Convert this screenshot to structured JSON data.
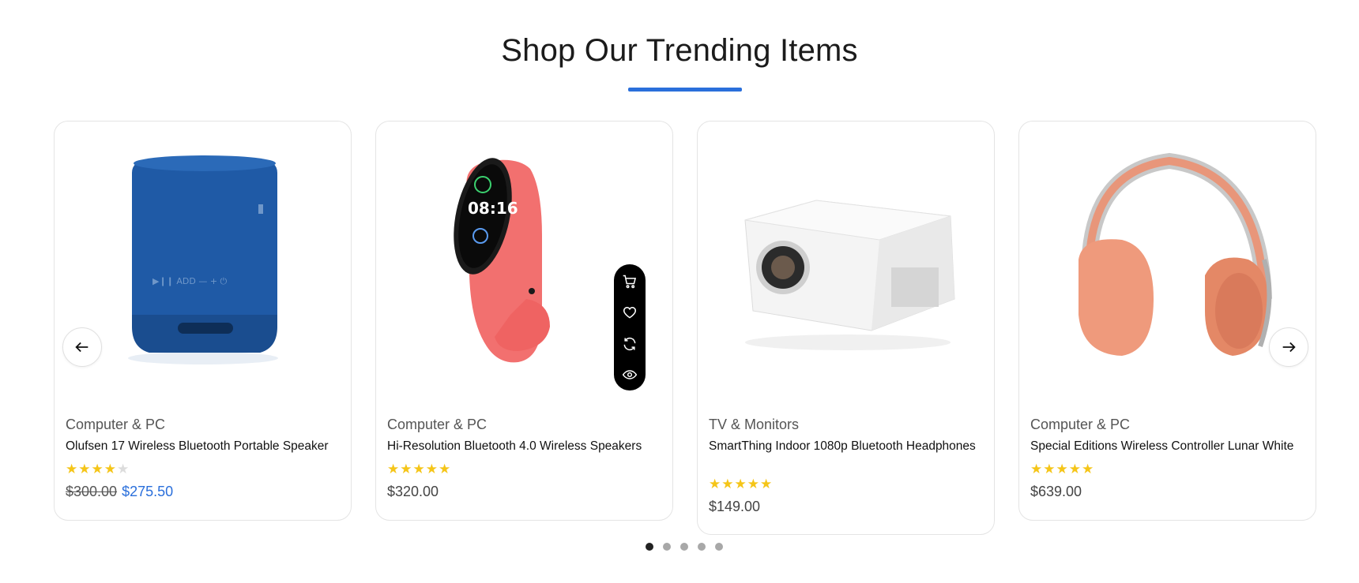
{
  "section": {
    "title": "Shop Our Trending Items",
    "accent_color": "#2a6fdb"
  },
  "products": [
    {
      "category": "Computer & PC",
      "name": "Olufsen 17 Wireless Bluetooth Portable Speaker",
      "rating": 4,
      "old_price": "$300.00",
      "price": "$275.50",
      "image_icon": "blue-speaker"
    },
    {
      "category": "Computer & PC",
      "name": "Hi-Resolution Bluetooth 4.0 Wireless Speakers",
      "rating": 5,
      "price": "$320.00",
      "image_icon": "smart-band-watch"
    },
    {
      "category": "TV & Monitors",
      "name": "SmartThing Indoor 1080p Bluetooth Headphones",
      "rating": 5,
      "price": "$149.00",
      "image_icon": "white-projector"
    },
    {
      "category": "Computer & PC",
      "name": "Special Editions Wireless Controller Lunar White",
      "rating": 5,
      "price": "$639.00",
      "image_icon": "orange-headphones"
    }
  ],
  "hover_actions": [
    "cart-icon",
    "heart-icon",
    "compare-icon",
    "eye-icon"
  ],
  "carousel": {
    "pages": 5,
    "active_page": 1
  },
  "star_glyph": "★"
}
